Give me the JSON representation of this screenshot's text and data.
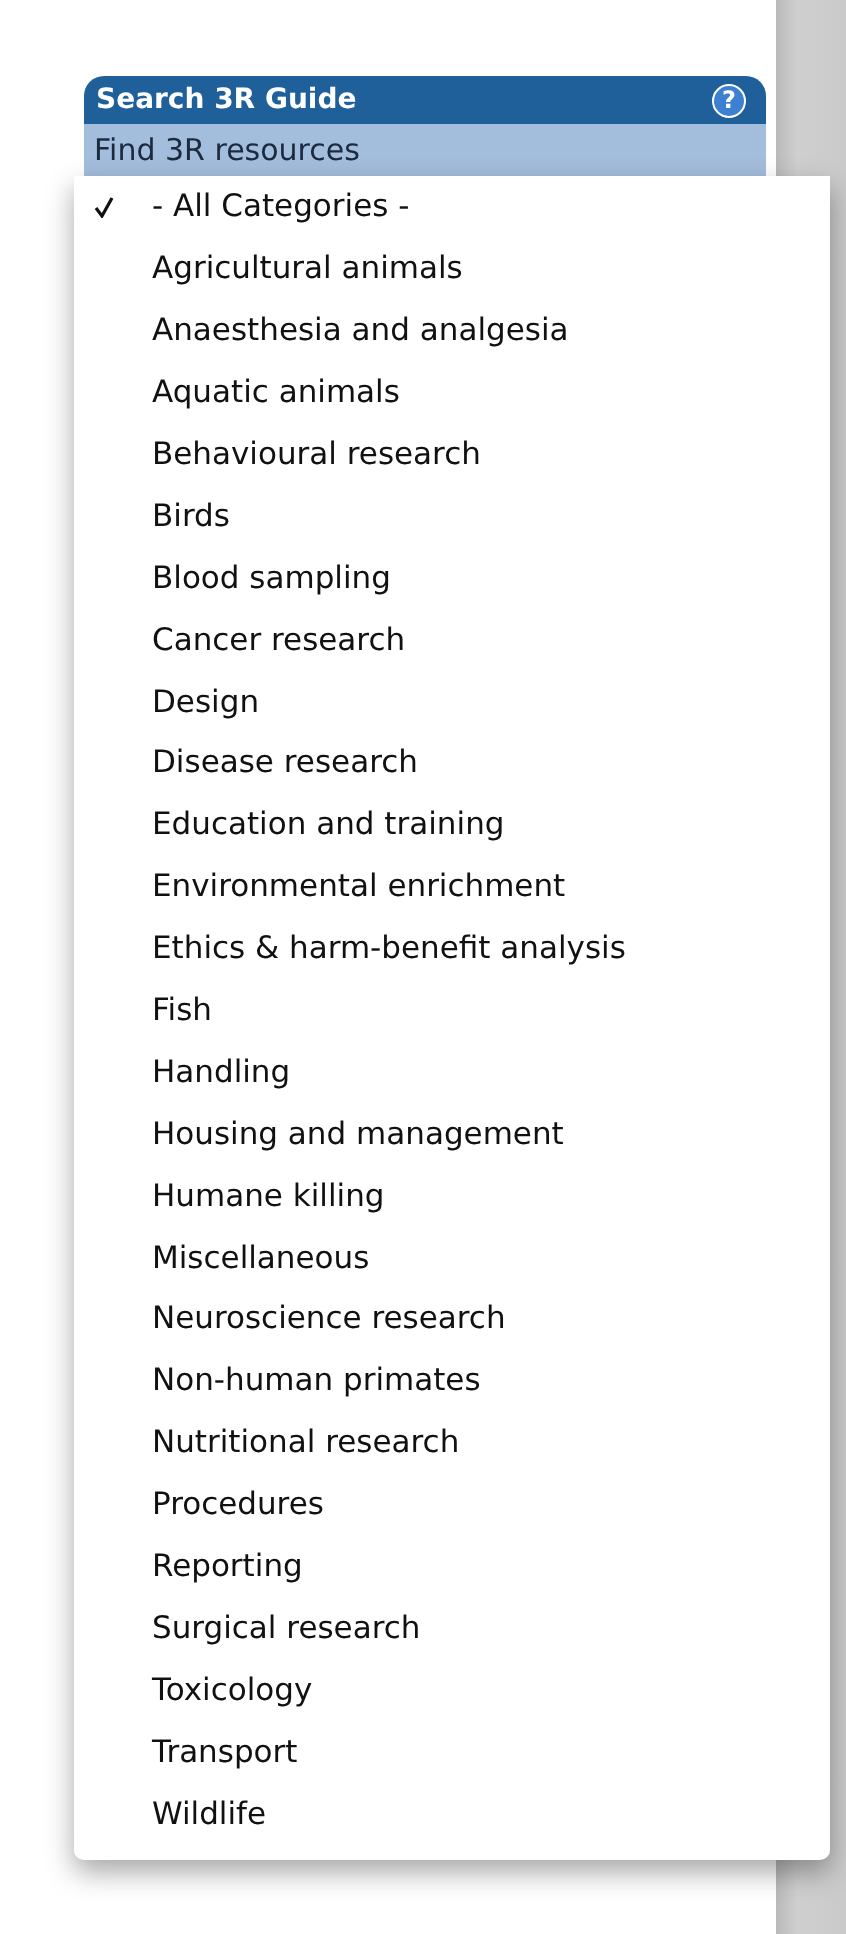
{
  "panel": {
    "title": "Search 3R Guide",
    "help_icon": "?",
    "subtitle": "Find 3R resources"
  },
  "menu": {
    "items": [
      {
        "label": "- All Categories -",
        "checked": true
      },
      {
        "label": "Agricultural animals",
        "checked": false
      },
      {
        "label": "Anaesthesia and analgesia",
        "checked": false
      },
      {
        "label": "Aquatic animals",
        "checked": false
      },
      {
        "label": "Behavioural research",
        "checked": false
      },
      {
        "label": "Birds",
        "checked": false
      },
      {
        "label": "Blood sampling",
        "checked": false
      },
      {
        "label": "Cancer research",
        "checked": false
      },
      {
        "label": "Design",
        "checked": false
      },
      {
        "label": "Disease research",
        "checked": false
      },
      {
        "label": "Education and training",
        "checked": false
      },
      {
        "label": "Environmental enrichment",
        "checked": false
      },
      {
        "label": "Ethics & harm-benefit analysis",
        "checked": false
      },
      {
        "label": "Fish",
        "checked": false
      },
      {
        "label": "Handling",
        "checked": false
      },
      {
        "label": "Housing and management",
        "checked": false
      },
      {
        "label": "Humane killing",
        "checked": false
      },
      {
        "label": "Miscellaneous",
        "checked": false
      },
      {
        "label": "Neuroscience research",
        "checked": false
      },
      {
        "label": "Non-human primates",
        "checked": false
      },
      {
        "label": "Nutritional research",
        "checked": false
      },
      {
        "label": "Procedures",
        "checked": false
      },
      {
        "label": "Reporting",
        "checked": false
      },
      {
        "label": "Surgical research",
        "checked": false
      },
      {
        "label": "Toxicology",
        "checked": false
      },
      {
        "label": "Transport",
        "checked": false
      },
      {
        "label": "Wildlife",
        "checked": false
      }
    ]
  }
}
